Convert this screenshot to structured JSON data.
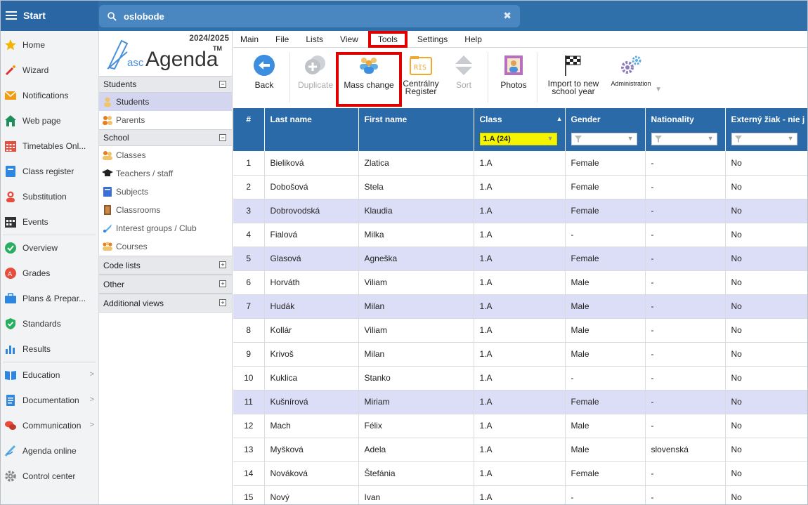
{
  "topbar": {
    "start_label": "Start",
    "search_value": "oslobode",
    "clear_glyph": "✖"
  },
  "nav": [
    {
      "label": "Home",
      "icon": "star-icon"
    },
    {
      "label": "Wizard",
      "icon": "magic-wand-icon"
    },
    {
      "label": "Notifications",
      "icon": "envelope-icon"
    },
    {
      "label": "Web page",
      "icon": "house-icon"
    },
    {
      "label": "Timetables Onl...",
      "icon": "timetable-icon"
    },
    {
      "label": "Class register",
      "icon": "register-book-icon"
    },
    {
      "label": "Substitution",
      "icon": "substitution-icon"
    },
    {
      "label": "Events",
      "icon": "calendar-icon"
    },
    {
      "label": "Overview",
      "icon": "check-circle-icon"
    },
    {
      "label": "Grades",
      "icon": "grades-icon"
    },
    {
      "label": "Plans & Prepar...",
      "icon": "briefcase-icon"
    },
    {
      "label": "Standards",
      "icon": "shield-check-icon"
    },
    {
      "label": "Results",
      "icon": "bar-chart-icon"
    },
    {
      "label": "Education",
      "icon": "book-open-icon"
    },
    {
      "label": "Documentation",
      "icon": "document-icon"
    },
    {
      "label": "Communication",
      "icon": "chat-bubbles-icon"
    },
    {
      "label": "Agenda online",
      "icon": "pen-icon"
    },
    {
      "label": "Control center",
      "icon": "gear-icon"
    }
  ],
  "col2": {
    "year": "2024/2025",
    "logo_prefix": "asc",
    "logo_main": "Agenda",
    "logo_tm": "TM",
    "students_header": "Students",
    "students_items": [
      "Students",
      "Parents"
    ],
    "school_header": "School",
    "school_items": [
      "Classes",
      "Teachers / staff",
      "Subjects",
      "Classrooms",
      "Interest groups / Club",
      "Courses"
    ],
    "code_lists": "Code lists",
    "other": "Other",
    "additional_views": "Additional views",
    "collapse_glyph": "−",
    "expand_glyph": "+"
  },
  "menu": [
    "Main",
    "File",
    "Lists",
    "View",
    "Tools",
    "Settings",
    "Help"
  ],
  "toolbar": {
    "back": "Back",
    "duplicate": "Duplicate",
    "mass_change": "Mass change",
    "centralny_1": "Centrálny",
    "centralny_2": "Register",
    "ris": "RIS",
    "sort": "Sort",
    "photos": "Photos",
    "import_1": "Import to new",
    "import_2": "school year",
    "administration": "Administration"
  },
  "table": {
    "headers": [
      "#",
      "Last name",
      "First name",
      "Class",
      "Gender",
      "Nationality",
      "Externý žiak - nie j"
    ],
    "class_filter": "1.A (24)",
    "rows": [
      [
        "1",
        "Bieliková",
        "Zlatica",
        "1.A",
        "Female",
        "-",
        "No"
      ],
      [
        "2",
        "Dobošová",
        "Stela",
        "1.A",
        "Female",
        "-",
        "No"
      ],
      [
        "3",
        "Dobrovodská",
        "Klaudia",
        "1.A",
        "Female",
        "-",
        "No"
      ],
      [
        "4",
        "Fialová",
        "Milka",
        "1.A",
        "-",
        "-",
        "No"
      ],
      [
        "5",
        "Glasová",
        "Agneška",
        "1.A",
        "Female",
        "-",
        "No"
      ],
      [
        "6",
        "Horváth",
        "Viliam",
        "1.A",
        "Male",
        "-",
        "No"
      ],
      [
        "7",
        "Hudák",
        "Milan",
        "1.A",
        "Male",
        "-",
        "No"
      ],
      [
        "8",
        "Kollár",
        "Viliam",
        "1.A",
        "Male",
        "-",
        "No"
      ],
      [
        "9",
        "Krivoš",
        "Milan",
        "1.A",
        "Male",
        "-",
        "No"
      ],
      [
        "10",
        "Kuklica",
        "Stanko",
        "1.A",
        "-",
        "-",
        "No"
      ],
      [
        "11",
        "Kušnírová",
        "Miriam",
        "1.A",
        "Female",
        "-",
        "No"
      ],
      [
        "12",
        "Mach",
        "Félix",
        "1.A",
        "Male",
        "-",
        "No"
      ],
      [
        "13",
        "Myšková",
        "Adela",
        "1.A",
        "Male",
        "slovenská",
        "No"
      ],
      [
        "14",
        "Nováková",
        "Štefánia",
        "1.A",
        "Female",
        "-",
        "No"
      ],
      [
        "15",
        "Nový",
        "Ivan",
        "1.A",
        "-",
        "-",
        "No"
      ]
    ],
    "highlighted_rows": [
      3,
      5,
      7,
      11
    ]
  },
  "colors": {
    "header_blue": "#2a6aa9",
    "row_highlight": "#dcddf7",
    "red_box": "#e00000",
    "filter_yellow": "#f5f500"
  }
}
